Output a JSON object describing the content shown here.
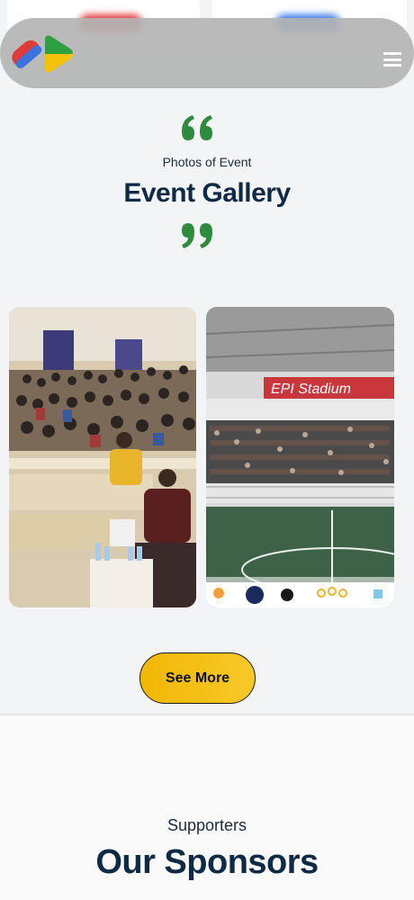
{
  "gallery": {
    "subtitle": "Photos of Event",
    "title": "Event Gallery",
    "see_more_label": "See More",
    "photos": [
      {
        "alt": "Audience in lecture hall"
      },
      {
        "alt": "Stadium with crowd",
        "banner": "EPI Stadium"
      }
    ]
  },
  "sponsors": {
    "subtitle": "Supporters",
    "title": "Our Sponsors"
  },
  "colors": {
    "accent_green": "#2e8b3d",
    "button_yellow": "#f2b705",
    "heading_navy": "#0f2a45"
  }
}
